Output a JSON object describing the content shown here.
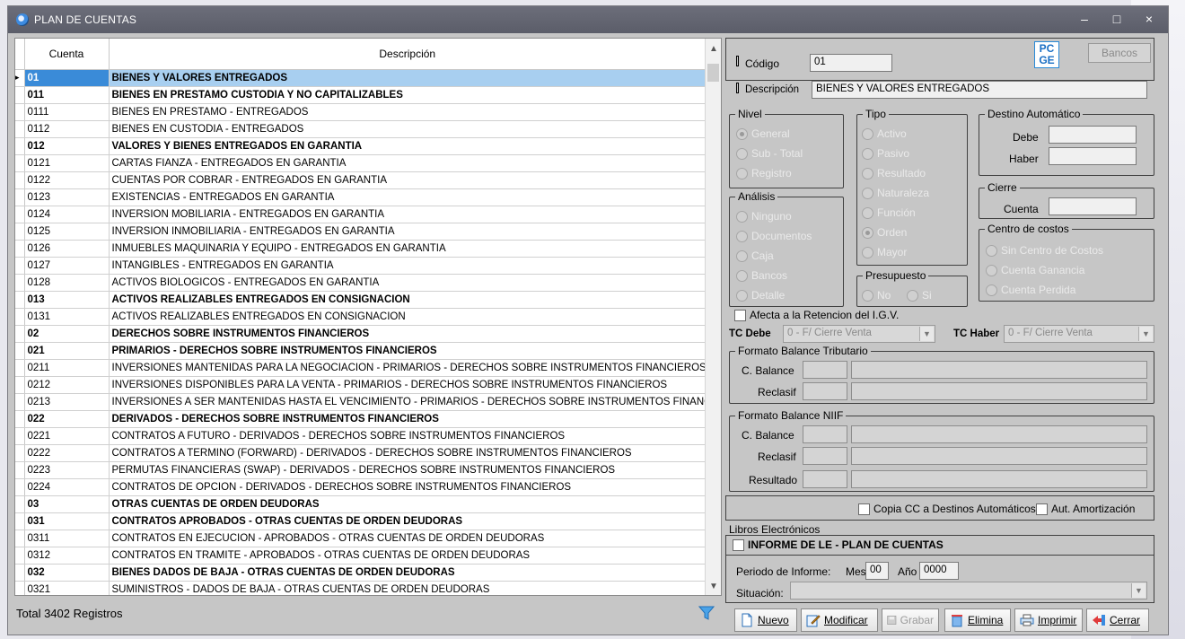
{
  "window": {
    "title": "PLAN DE CUENTAS",
    "minimize": "–",
    "maximize": "□",
    "close": "×"
  },
  "grid": {
    "columns": [
      "Cuenta",
      "Descripción"
    ],
    "selected_index": 0,
    "rows": [
      {
        "cuenta": "01",
        "desc": "BIENES Y VALORES ENTREGADOS",
        "bold": true
      },
      {
        "cuenta": "011",
        "desc": "BIENES EN PRESTAMO  CUSTODIA Y NO CAPITALIZABLES",
        "bold": true
      },
      {
        "cuenta": "0111",
        "desc": "BIENES EN PRESTAMO - ENTREGADOS",
        "bold": false
      },
      {
        "cuenta": "0112",
        "desc": "BIENES EN CUSTODIA - ENTREGADOS",
        "bold": false
      },
      {
        "cuenta": "012",
        "desc": "VALORES Y BIENES ENTREGADOS EN GARANTIA",
        "bold": true
      },
      {
        "cuenta": "0121",
        "desc": "CARTAS FIANZA - ENTREGADOS EN GARANTIA",
        "bold": false
      },
      {
        "cuenta": "0122",
        "desc": "CUENTAS POR COBRAR - ENTREGADOS EN GARANTIA",
        "bold": false
      },
      {
        "cuenta": "0123",
        "desc": "EXISTENCIAS - ENTREGADOS EN GARANTIA",
        "bold": false
      },
      {
        "cuenta": "0124",
        "desc": "INVERSION MOBILIARIA - ENTREGADOS EN GARANTIA",
        "bold": false
      },
      {
        "cuenta": "0125",
        "desc": "INVERSION INMOBILIARIA - ENTREGADOS EN GARANTIA",
        "bold": false
      },
      {
        "cuenta": "0126",
        "desc": "INMUEBLES  MAQUINARIA Y EQUIPO - ENTREGADOS EN GARANTIA",
        "bold": false
      },
      {
        "cuenta": "0127",
        "desc": "INTANGIBLES - ENTREGADOS EN GARANTIA",
        "bold": false
      },
      {
        "cuenta": "0128",
        "desc": "ACTIVOS BIOLOGICOS - ENTREGADOS EN GARANTIA",
        "bold": false
      },
      {
        "cuenta": "013",
        "desc": "ACTIVOS REALIZABLES ENTREGADOS EN CONSIGNACION",
        "bold": true
      },
      {
        "cuenta": "0131",
        "desc": "ACTIVOS REALIZABLES ENTREGADOS EN CONSIGNACION",
        "bold": false
      },
      {
        "cuenta": "02",
        "desc": "DERECHOS SOBRE INSTRUMENTOS FINANCIEROS",
        "bold": true
      },
      {
        "cuenta": "021",
        "desc": "PRIMARIOS - DERECHOS SOBRE INSTRUMENTOS FINANCIEROS",
        "bold": true
      },
      {
        "cuenta": "0211",
        "desc": "INVERSIONES MANTENIDAS PARA LA NEGOCIACION - PRIMARIOS - DERECHOS SOBRE INSTRUMENTOS FINANCIEROS",
        "bold": false
      },
      {
        "cuenta": "0212",
        "desc": "INVERSIONES DISPONIBLES PARA LA VENTA - PRIMARIOS - DERECHOS SOBRE INSTRUMENTOS FINANCIEROS",
        "bold": false
      },
      {
        "cuenta": "0213",
        "desc": "INVERSIONES A SER MANTENIDAS HASTA EL VENCIMIENTO - PRIMARIOS - DERECHOS SOBRE INSTRUMENTOS FINANCIEROS",
        "bold": false
      },
      {
        "cuenta": "022",
        "desc": "DERIVADOS - DERECHOS SOBRE INSTRUMENTOS FINANCIEROS",
        "bold": true
      },
      {
        "cuenta": "0221",
        "desc": "CONTRATOS A FUTURO - DERIVADOS - DERECHOS SOBRE INSTRUMENTOS FINANCIEROS",
        "bold": false
      },
      {
        "cuenta": "0222",
        "desc": "CONTRATOS A TERMINO (FORWARD) - DERIVADOS - DERECHOS SOBRE INSTRUMENTOS FINANCIEROS",
        "bold": false
      },
      {
        "cuenta": "0223",
        "desc": "PERMUTAS FINANCIERAS (SWAP) - DERIVADOS - DERECHOS SOBRE INSTRUMENTOS FINANCIEROS",
        "bold": false
      },
      {
        "cuenta": "0224",
        "desc": "CONTRATOS DE OPCION - DERIVADOS - DERECHOS SOBRE INSTRUMENTOS FINANCIEROS",
        "bold": false
      },
      {
        "cuenta": "03",
        "desc": "OTRAS CUENTAS DE ORDEN DEUDORAS",
        "bold": true
      },
      {
        "cuenta": "031",
        "desc": "CONTRATOS APROBADOS - OTRAS CUENTAS DE ORDEN DEUDORAS",
        "bold": true
      },
      {
        "cuenta": "0311",
        "desc": "CONTRATOS EN EJECUCION - APROBADOS - OTRAS CUENTAS DE ORDEN DEUDORAS",
        "bold": false
      },
      {
        "cuenta": "0312",
        "desc": "CONTRATOS EN TRAMITE - APROBADOS - OTRAS CUENTAS DE ORDEN DEUDORAS",
        "bold": false
      },
      {
        "cuenta": "032",
        "desc": "BIENES DADOS DE BAJA - OTRAS CUENTAS DE ORDEN DEUDORAS",
        "bold": true
      },
      {
        "cuenta": "0321",
        "desc": "SUMINISTROS - DADOS DE BAJA - OTRAS CUENTAS DE ORDEN DEUDORAS",
        "bold": false
      }
    ]
  },
  "status": {
    "total": "Total 3402 Registros"
  },
  "form": {
    "codigo_label": "Código",
    "codigo_value": "01",
    "pcge_logo": "PC\nGE",
    "bancos_label": "Bancos",
    "descripcion_label": "Descripción",
    "descripcion_value": "BIENES Y VALORES ENTREGADOS",
    "nivel": {
      "legend": "Nivel",
      "options": [
        "General",
        "Sub - Total",
        "Registro"
      ],
      "selected": "General"
    },
    "tipo": {
      "legend": "Tipo",
      "options": [
        "Activo",
        "Pasivo",
        "Resultado",
        "Naturaleza",
        "Función",
        "Orden",
        "Mayor"
      ],
      "selected": "Orden"
    },
    "destino": {
      "legend": "Destino Automático",
      "debe_label": "Debe",
      "haber_label": "Haber"
    },
    "cierre": {
      "legend": "Cierre",
      "cuenta_label": "Cuenta"
    },
    "analisis": {
      "legend": "Análisis",
      "options": [
        "Ninguno",
        "Documentos",
        "Caja",
        "Bancos",
        "Detalle"
      ]
    },
    "presupuesto": {
      "legend": "Presupuesto",
      "options": [
        "No",
        "Si"
      ]
    },
    "centro": {
      "legend": "Centro de costos",
      "options": [
        "Sin Centro de Costos",
        "Cuenta Ganancia",
        "Cuenta Perdida"
      ]
    },
    "igv_label": "Afecta a la Retencion del I.G.V.",
    "tc_debe_label": "TC Debe",
    "tc_debe_value": "0 - F/ Cierre Venta",
    "tc_haber_label": "TC Haber",
    "tc_haber_value": "0 - F/ Cierre Venta",
    "tributario": {
      "legend": "Formato Balance Tributario",
      "c_balance": "C. Balance",
      "reclasif": "Reclasif"
    },
    "niif": {
      "legend": "Formato Balance NIIF",
      "c_balance": "C. Balance",
      "reclasif": "Reclasif",
      "resultado": "Resultado"
    },
    "copia_cc_label": "Copia CC a Destinos Automáticos",
    "aut_amort_label": "Aut. Amortización",
    "libros": {
      "legend": "Libros Electrónicos",
      "informe_label": "INFORME DE LE - PLAN DE CUENTAS",
      "periodo_label": "Periodo de Informe:",
      "mes_label": "Mes",
      "mes_value": "00",
      "anio_label": "Año",
      "anio_value": "0000",
      "situacion_label": "Situación:"
    }
  },
  "toolbar": {
    "nuevo": "Nuevo",
    "modificar": "Modificar",
    "grabar": "Grabar",
    "elimina": "Elimina",
    "imprimir": "Imprimir",
    "cerrar": "Cerrar"
  }
}
